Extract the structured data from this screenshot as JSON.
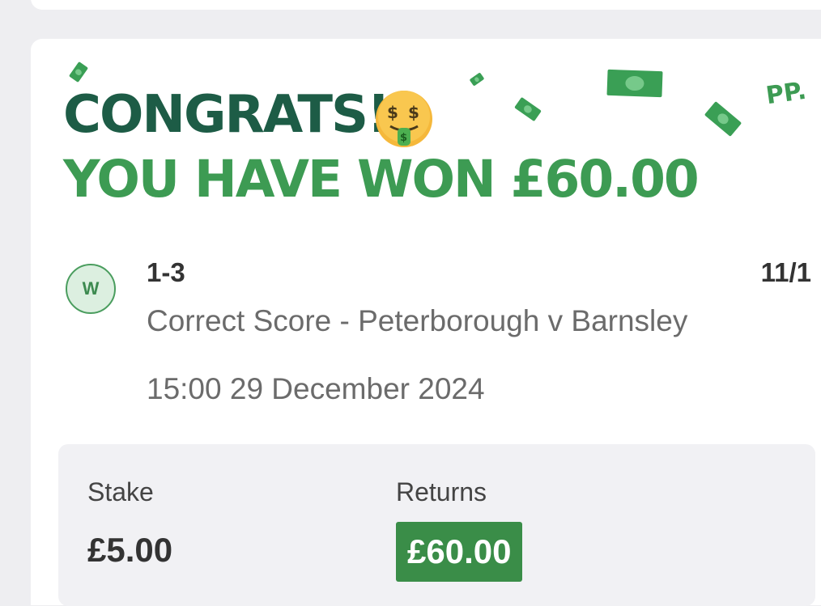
{
  "bet_result": {
    "congrats": "CONGRATS!",
    "won_message": "YOU HAVE WON £60.00",
    "brand_mark": "PP.",
    "emoji_name": "money-mouth-face-icon"
  },
  "selection": {
    "status_badge": "W",
    "score": "1-3",
    "odds": "11/1",
    "market": "Correct Score - Peterborough v Barnsley",
    "datetime": "15:00 29 December 2024"
  },
  "summary": {
    "stake_label": "Stake",
    "stake_value": "£5.00",
    "returns_label": "Returns",
    "returns_value": "£60.00"
  },
  "colors": {
    "title_dark_green": "#1d5c46",
    "title_green": "#3d9b53",
    "returns_green": "#3a8d48",
    "badge_bg": "#dcefe0"
  }
}
